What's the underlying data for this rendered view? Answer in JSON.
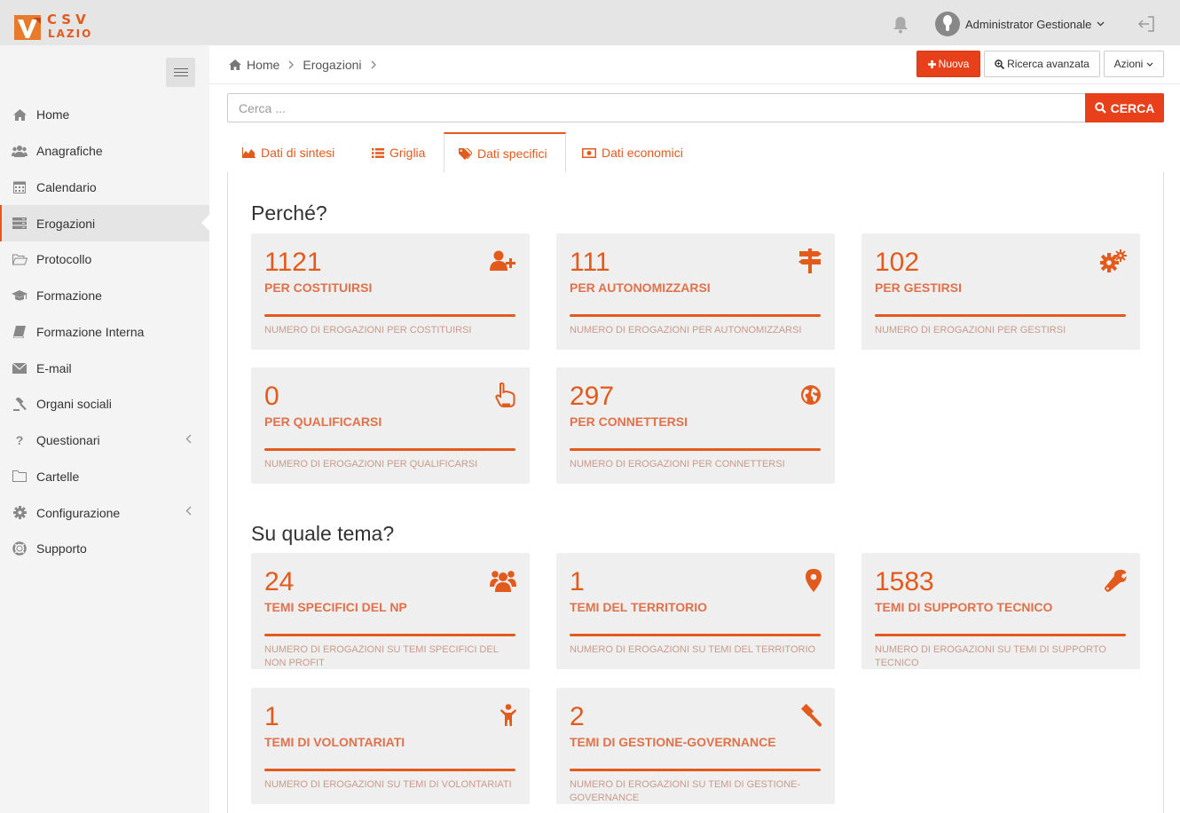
{
  "brand": {
    "line1": "CSV",
    "line2": "LAZIO"
  },
  "colors": {
    "accent": "#e25a1c",
    "button": "#e8401a"
  },
  "user": {
    "name": "Administrator Gestionale"
  },
  "sidebar": {
    "items": [
      {
        "label": "Home",
        "icon": "home-icon"
      },
      {
        "label": "Anagrafiche",
        "icon": "users-icon"
      },
      {
        "label": "Calendario",
        "icon": "calendar-icon"
      },
      {
        "label": "Erogazioni",
        "icon": "server-icon",
        "active": true
      },
      {
        "label": "Protocollo",
        "icon": "folder-open-icon"
      },
      {
        "label": "Formazione",
        "icon": "graduation-cap-icon"
      },
      {
        "label": "Formazione Interna",
        "icon": "book-icon"
      },
      {
        "label": "E-mail",
        "icon": "envelope-icon"
      },
      {
        "label": "Organi sociali",
        "icon": "gavel-icon"
      },
      {
        "label": "Questionari",
        "icon": "question-icon",
        "has_children": true
      },
      {
        "label": "Cartelle",
        "icon": "folder-icon"
      },
      {
        "label": "Configurazione",
        "icon": "gear-icon",
        "has_children": true
      },
      {
        "label": "Supporto",
        "icon": "life-ring-icon"
      }
    ]
  },
  "breadcrumb": {
    "home": "Home",
    "current": "Erogazioni"
  },
  "toolbar": {
    "new_label": "Nuova",
    "advanced_label": "Ricerca avanzata",
    "actions_label": "Azioni"
  },
  "search": {
    "placeholder": "Cerca ...",
    "value": "",
    "button_label": "CERCA"
  },
  "tabs": [
    {
      "label": "Dati di sintesi",
      "icon": "area-chart-icon"
    },
    {
      "label": "Griglia",
      "icon": "list-icon"
    },
    {
      "label": "Dati specifici",
      "icon": "tags-icon",
      "active": true
    },
    {
      "label": "Dati economici",
      "icon": "money-icon"
    }
  ],
  "sections": [
    {
      "title": "Perché?",
      "cards": [
        {
          "value": "1121",
          "label": "PER COSTITUIRSI",
          "desc": "NUMERO DI EROGAZIONI PER COSTITUIRSI",
          "icon": "user-plus-icon"
        },
        {
          "value": "111",
          "label": "PER AUTONOMIZZARSI",
          "desc": "NUMERO DI EROGAZIONI PER AUTONOMIZZARSI",
          "icon": "signpost-icon"
        },
        {
          "value": "102",
          "label": "PER GESTIRSI",
          "desc": "NUMERO DI EROGAZIONI PER GESTIRSI",
          "icon": "gears-icon"
        },
        {
          "value": "0",
          "label": "PER QUALIFICARSI",
          "desc": "NUMERO DI EROGAZIONI PER QUALIFICARSI",
          "icon": "hand-pointer-icon"
        },
        {
          "value": "297",
          "label": "PER CONNETTERSI",
          "desc": "NUMERO DI EROGAZIONI PER CONNETTERSI",
          "icon": "globe-icon"
        }
      ]
    },
    {
      "title": "Su quale tema?",
      "cards": [
        {
          "value": "24",
          "label": "TEMI SPECIFICI DEL NP",
          "desc": "NUMERO DI EROGAZIONI SU TEMI SPECIFICI DEL NON PROFIT",
          "icon": "users-icon"
        },
        {
          "value": "1",
          "label": "TEMI DEL TERRITORIO",
          "desc": "NUMERO DI EROGAZIONI SU TEMI DEL TERRITORIO",
          "icon": "map-marker-icon"
        },
        {
          "value": "1583",
          "label": "TEMI DI SUPPORTO TECNICO",
          "desc": "NUMERO DI EROGAZIONI SU TEMI DI SUPPORTO TECNICO",
          "icon": "wrench-icon"
        },
        {
          "value": "1",
          "label": "TEMI DI VOLONTARIATI",
          "desc": "NUMERO DI EROGAZIONI SU TEMI DI VOLONTARIATI",
          "icon": "child-icon"
        },
        {
          "value": "2",
          "label": "TEMI DI GESTIONE-GOVERNANCE",
          "desc": "NUMERO DI EROGAZIONI SU TEMI DI GESTIONE-GOVERNANCE",
          "icon": "gavel-icon"
        }
      ]
    }
  ]
}
